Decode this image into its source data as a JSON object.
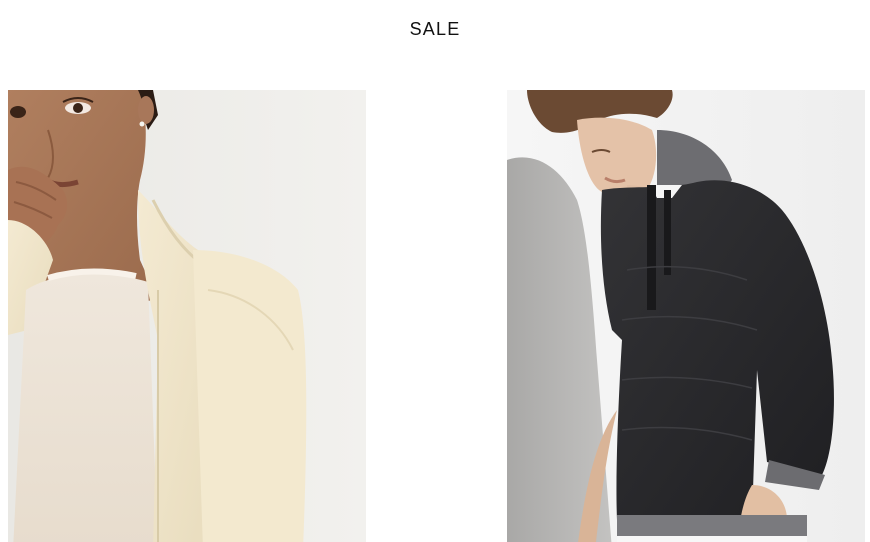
{
  "header": {
    "title": "SALE"
  },
  "products": [
    {
      "image_alt": "woman-in-cream-cardigan",
      "link_label": ""
    },
    {
      "image_alt": "man-in-black-hoodie",
      "link_label": ""
    }
  ],
  "colors": {
    "background": "#ffffff",
    "title_text": "#111111",
    "cardigan_cream": "#f1e6cb",
    "hoodie_black": "#2a2a2c",
    "hoodie_hood_gray": "#6e6e72"
  }
}
